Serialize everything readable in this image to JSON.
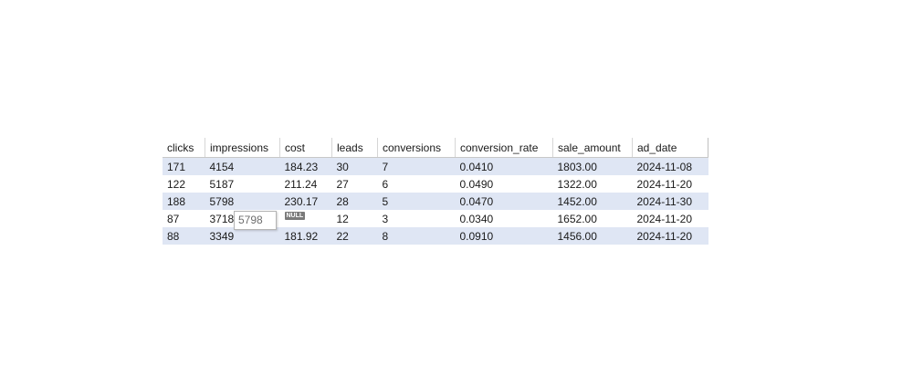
{
  "grid": {
    "columns": [
      "clicks",
      "impressions",
      "cost",
      "leads",
      "conversions",
      "conversion_rate",
      "sale_amount",
      "ad_date"
    ],
    "rows": [
      [
        "171",
        "4154",
        "184.23",
        "30",
        "7",
        "0.0410",
        "1803.00",
        "2024-11-08"
      ],
      [
        "122",
        "5187",
        "211.24",
        "27",
        "6",
        "0.0490",
        "1322.00",
        "2024-11-20"
      ],
      [
        "188",
        "5798",
        "230.17",
        "28",
        "5",
        "0.0470",
        "1452.00",
        "2024-11-30"
      ],
      [
        "87",
        "3718",
        "",
        "12",
        "3",
        "0.0340",
        "1652.00",
        "2024-11-20"
      ],
      [
        "88",
        "3349",
        "181.92",
        "22",
        "8",
        "0.0910",
        "1456.00",
        "2024-11-20"
      ]
    ],
    "null_label": "NULL",
    "editor_value": "5798"
  }
}
